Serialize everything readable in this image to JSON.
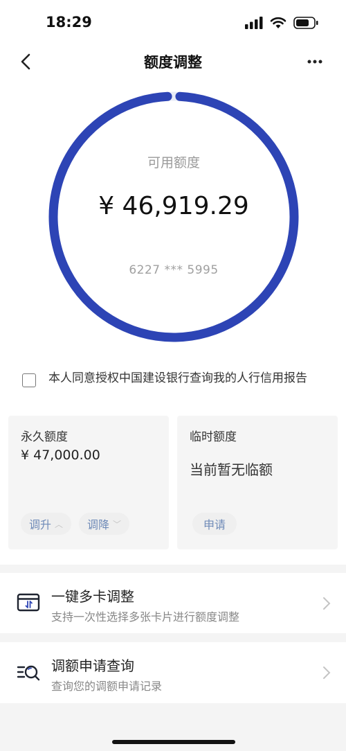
{
  "status": {
    "time": "18:29",
    "icons": [
      "signal-icon",
      "wifi-icon",
      "battery-icon"
    ]
  },
  "nav": {
    "title": "额度调整",
    "back_icon": "chevron-left-icon",
    "more_icon": "more-icon"
  },
  "credit": {
    "label": "可用额度",
    "amount": "¥ 46,919.29",
    "card_number": "6227 *** 5995",
    "ring_color": "#2d44b5",
    "ring_track_color": "#e8ecf7",
    "available_fraction": 0.998
  },
  "consent": {
    "checked": false,
    "text": "本人同意授权中国建设银行查询我的人行信用报告"
  },
  "permanent": {
    "title": "永久额度",
    "value": "¥  47,000.00",
    "raise_label": "调升",
    "lower_label": "调降"
  },
  "temporary": {
    "title": "临时额度",
    "empty_text": "当前暂无临额",
    "apply_label": "申请"
  },
  "menu": [
    {
      "title": "一键多卡调整",
      "subtitle": "支持一次性选择多张卡片进行额度调整",
      "icon": "multi-card-icon"
    },
    {
      "title": "调额申请查询",
      "subtitle": "查询您的调额申请记录",
      "icon": "search-list-icon"
    }
  ],
  "colors": {
    "accent": "#2d44b5",
    "pill_text": "#6f8bb8",
    "card_bg": "#f5f5f5"
  }
}
